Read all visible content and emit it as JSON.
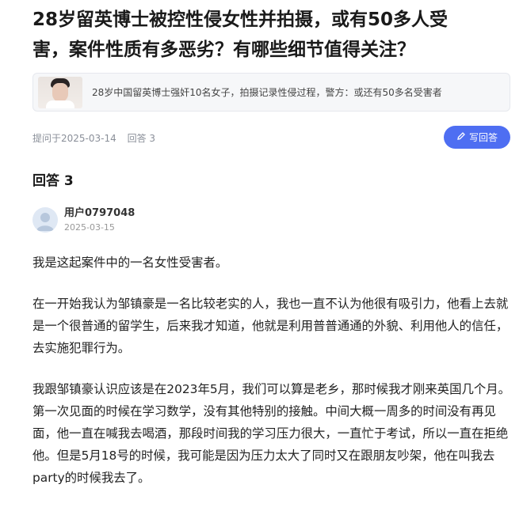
{
  "question": {
    "title_line1": "28岁留英博士被控性侵女性并拍摄，或有50多人受",
    "title_line2": "害，案件性质有多恶劣？有哪些细节值得关注？",
    "link_card_text": "28岁中国留英博士强奸10名女子，拍摄记录性侵过程，警方：或还有50多名受害者",
    "asked_at": "提问于2025-03-14",
    "answer_count": "回答 3",
    "write_answer_label": "写回答"
  },
  "answers": {
    "heading": "回答 3",
    "first": {
      "author_name": "用户0797048",
      "date": "2025-03-15",
      "paragraphs": [
        "我是这起案件中的一名女性受害者。",
        "在一开始我认为邹镇豪是一名比较老实的人，我也一直不认为他很有吸引力，他看上去就是一个很普通的留学生，后来我才知道，他就是利用普普通通的外貌、利用他人的信任，去实施犯罪行为。",
        "我跟邹镇豪认识应该是在2023年5月，我们可以算是老乡，那时候我才刚来英国几个月。第一次见面的时候在学习数学，没有其他特别的接触。中间大概一周多的时间没有再见面，他一直在喊我去喝酒，那段时间我的学习压力很大，一直忙于考试，所以一直在拒绝他。但是5月18号的时候，我可能是因为压力太大了同时又在跟朋友吵架，他在叫我去party的时候我去了。"
      ]
    }
  },
  "colors": {
    "accent": "#4e6ef2",
    "muted": "#8a8f99"
  },
  "icons": {
    "write": "pencil-icon",
    "avatar": "user-avatar-icon"
  }
}
